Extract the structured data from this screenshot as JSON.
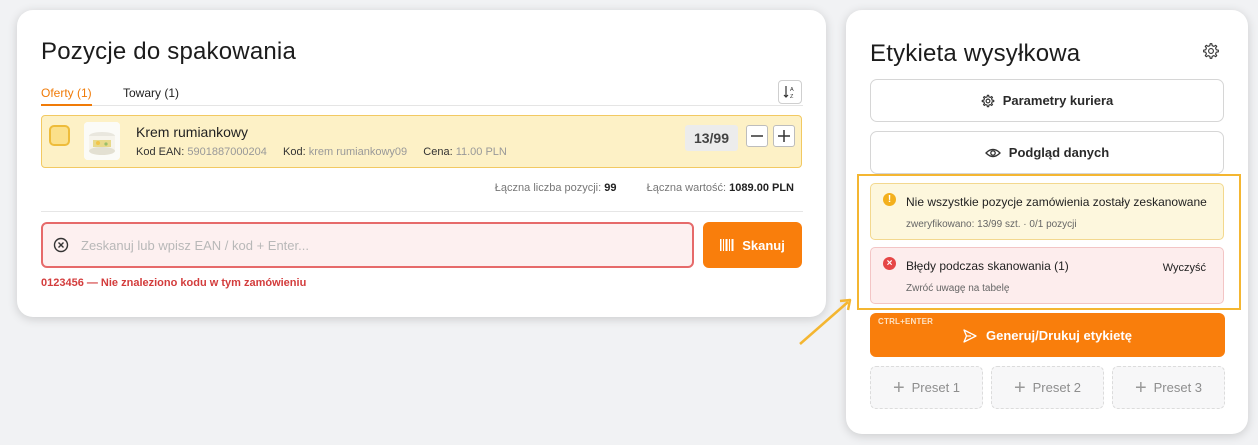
{
  "left": {
    "title": "Pozycje do spakowania",
    "tabs": [
      {
        "label": "Oferty (1)",
        "active": true
      },
      {
        "label": "Towary (1)",
        "active": false
      }
    ],
    "item": {
      "name": "Krem rumiankowy",
      "ean_label": "Kod EAN:",
      "ean_value": "5901887000204",
      "code_label": "Kod:",
      "code_value": "krem rumiankowy09",
      "price_label": "Cena:",
      "price_value": "11.00 PLN",
      "quantity": "13/99",
      "minus": "−",
      "plus": "+"
    },
    "totals": {
      "count_label": "Łączna liczba pozycji:",
      "count_value": "99",
      "value_label": "Łączna wartość:",
      "value_value": "1089.00 PLN"
    },
    "scan": {
      "placeholder": "Zeskanuj lub wpisz EAN / kod + Enter...",
      "button_label": "Skanuj",
      "error": "0123456 — Nie znaleziono kodu w tym zamówieniu"
    }
  },
  "right": {
    "title": "Etykieta wysyłkowa",
    "courier_button": "Parametry kuriera",
    "preview_button": "Podgląd danych",
    "warning": {
      "icon": "!",
      "title": "Nie wszystkie pozycje zamówienia zostały zeskanowane",
      "subtitle": "zweryfikowano: 13/99 szt. · 0/1 pozycji"
    },
    "errors": {
      "icon": "×",
      "title": "Błędy podczas skanowania (1)",
      "subtitle": "Zwróć uwagę na tabelę",
      "clear_label": "Wyczyść"
    },
    "generate": {
      "shortcut": "CTRL+ENTER",
      "label": "Generuj/Drukuj etykietę"
    },
    "presets": [
      "Preset 1",
      "Preset 2",
      "Preset 3"
    ],
    "preset_plus": "+"
  },
  "colors": {
    "accent": "#f97e0c",
    "warning_bg": "#fdf7dd",
    "error_bg": "#fdeded",
    "highlight": "#f4b631",
    "error_text": "#d33c3c"
  }
}
